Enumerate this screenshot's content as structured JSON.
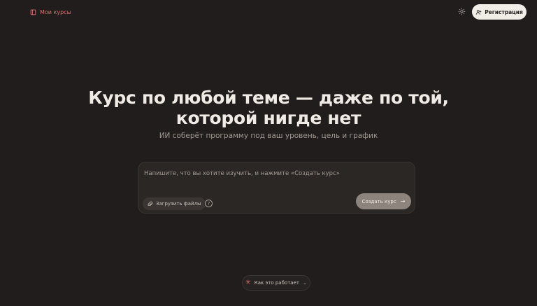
{
  "header": {
    "my_courses_label": "Мои курсы",
    "register_label": "Регистрация"
  },
  "hero": {
    "title_line1": "Курс по любой теме — даже по той,",
    "title_line2": "которой нигде нет",
    "subtitle": "ИИ соберёт программу под ваш уровень, цель и график"
  },
  "prompt": {
    "placeholder": "Напишите, что вы хотите изучить, и нажмите «Создать курс»",
    "upload_label": "Загрузить файлы",
    "create_label": "Создать курс"
  },
  "footer": {
    "how_it_works_label": "Как это работает"
  },
  "colors": {
    "background": "#201d1c",
    "accent": "#d9746d",
    "register_bg": "#f1ede7",
    "create_btn_bg": "#8c847d"
  },
  "icons": {
    "my_courses": "book-icon",
    "settings": "gear-icon",
    "register": "add-user-icon",
    "upload": "paperclip-icon",
    "help": "question-circle-icon",
    "create": "arrow-right-icon",
    "how_it_works": "sparkle-icon",
    "dropdown": "chevron-down-icon"
  }
}
